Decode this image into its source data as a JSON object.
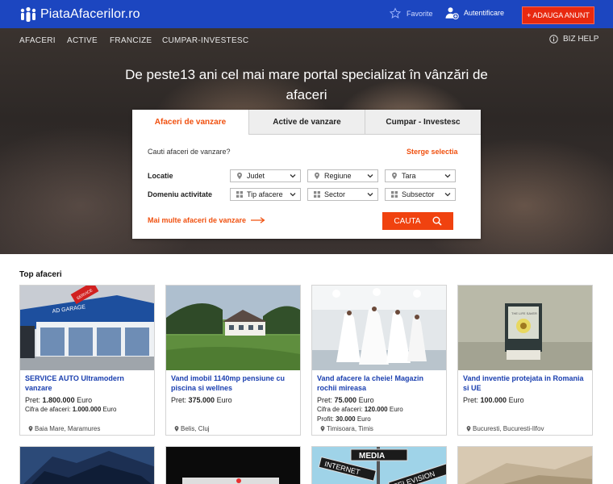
{
  "header": {
    "logo_text": "PiataAfacerilor.ro",
    "favorites_label": "Favorite",
    "login_label": "Autentificare",
    "add_listing_label": "+ ADAUGA ANUNT"
  },
  "nav": {
    "items": [
      "AFACERI",
      "ACTIVE",
      "FRANCIZE",
      "CUMPAR-INVESTESC"
    ],
    "help_label": "BIZ HELP"
  },
  "hero": {
    "title": "De peste13 ani cel mai mare portal specializat în vânzări de afaceri"
  },
  "search": {
    "tabs": [
      "Afaceri de vanzare",
      "Active de vanzare",
      "Cumpar - Investesc"
    ],
    "question": "Cauti afaceri de vanzare?",
    "clear_label": "Sterge selectia",
    "location_label": "Locatie",
    "domain_label": "Domeniu activitate",
    "county": "Judet",
    "region": "Regiune",
    "country": "Tara",
    "business_type": "Tip afacere",
    "sector": "Sector",
    "subsector": "Subsector",
    "more_link": "Mai multe afaceri de vanzare",
    "search_button": "CAUTA"
  },
  "listings": {
    "section_title": "Top afaceri",
    "cards": [
      {
        "title": "SERVICE AUTO Ultramodern vanzare",
        "price_label": "Pret:",
        "price": "1.800.000",
        "currency": "Euro",
        "extra1_label": "Cifra de afaceri:",
        "extra1_value": "1.000.000",
        "extra1_currency": "Euro",
        "location": "Baia Mare, Maramures"
      },
      {
        "title": "Vand imobil 1140mp pensiune cu piscina si wellnes",
        "price_label": "Pret:",
        "price": "375.000",
        "currency": "Euro",
        "location": "Belis, Cluj"
      },
      {
        "title": "Vand afacere la cheie! Magazin rochii mireasa",
        "price_label": "Pret:",
        "price": "75.000",
        "currency": "Euro",
        "extra1_label": "Cifra de afaceri:",
        "extra1_value": "120.000",
        "extra1_currency": "Euro",
        "extra2_label": "Profit:",
        "extra2_value": "30.000",
        "extra2_currency": "Euro",
        "location": "Timisoara, Timis"
      },
      {
        "title": "Vand inventie protejata in Romania si UE",
        "price_label": "Pret:",
        "price": "100.000",
        "currency": "Euro",
        "location": "Bucuresti, Bucuresti-Ilfov"
      }
    ],
    "banner_texts": {
      "garage_sign": "AD GARAGE",
      "badge_top": "SERVICE",
      "phone_badge": "THE LIFE SAVER",
      "media": "MEDIA",
      "internet": "INTERNET",
      "television": "TELEVISION"
    }
  },
  "colors": {
    "brand_blue": "#1c46c0",
    "accent_orange": "#f0500f",
    "add_red": "#e8290f",
    "link_blue": "#1a3faf"
  }
}
